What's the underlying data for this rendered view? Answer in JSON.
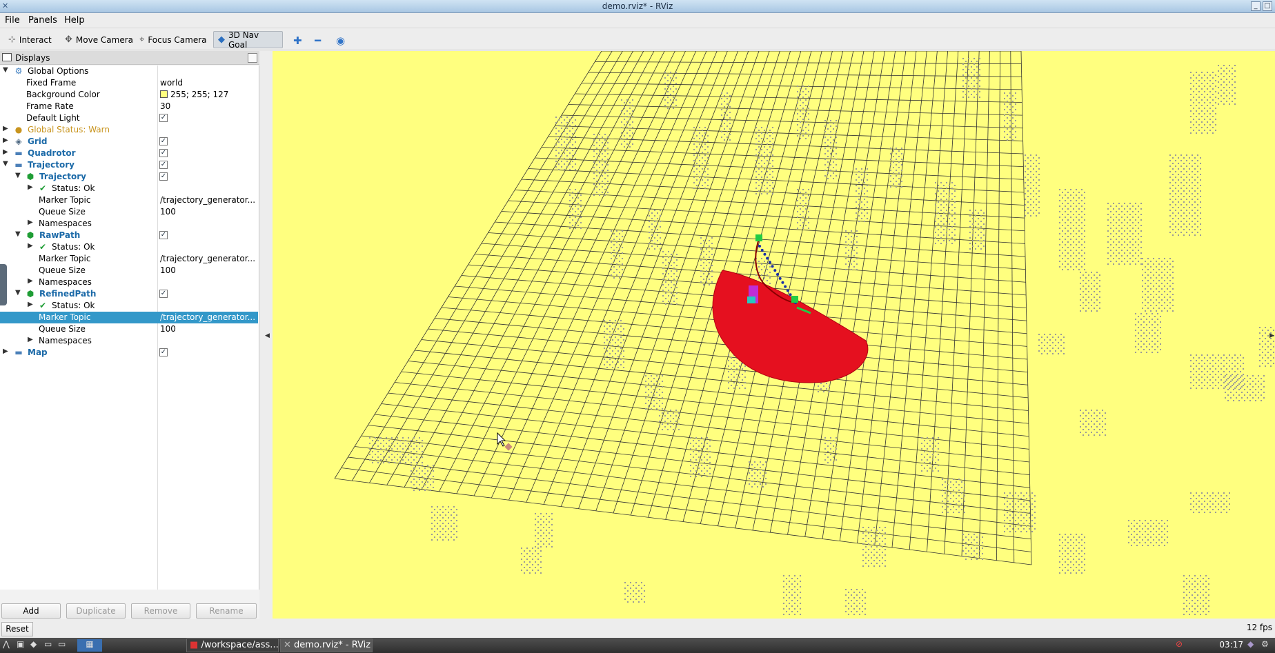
{
  "window": {
    "title": "demo.rviz* - RViz"
  },
  "menu": {
    "file": "File",
    "panels": "Panels",
    "help": "Help"
  },
  "toolbar": {
    "interact": "Interact",
    "move_camera": "Move Camera",
    "focus_camera": "Focus Camera",
    "nav_goal": "3D Nav Goal"
  },
  "displays": {
    "title": "Displays",
    "rows": {
      "global_options": "Global Options",
      "fixed_frame": "Fixed Frame",
      "fixed_frame_val": "world",
      "background_color": "Background Color",
      "background_color_val": "255; 255; 127",
      "frame_rate": "Frame Rate",
      "frame_rate_val": "30",
      "default_light": "Default Light",
      "global_status": "Global Status: Warn",
      "grid": "Grid",
      "quadrotor": "Quadrotor",
      "trajectory_group": "Trajectory",
      "trajectory": "Trajectory",
      "status_ok": "Status: Ok",
      "marker_topic": "Marker Topic",
      "marker_topic_val": "/trajectory_generator...",
      "queue_size": "Queue Size",
      "queue_size_val": "100",
      "namespaces": "Namespaces",
      "rawpath": "RawPath",
      "refinedpath": "RefinedPath",
      "map": "Map"
    }
  },
  "buttons": {
    "add": "Add",
    "duplicate": "Duplicate",
    "remove": "Remove",
    "rename": "Rename",
    "reset": "Reset"
  },
  "status": {
    "fps": "12 fps"
  },
  "taskbar": {
    "task1": "/workspace/ass...",
    "task2": "demo.rviz* - RViz",
    "clock": "03:17"
  },
  "colors": {
    "viewport_bg": "#ffff7f",
    "selection": "#3398c9",
    "sphere": "#e5101f",
    "obstacle": "#9a9a9a"
  }
}
